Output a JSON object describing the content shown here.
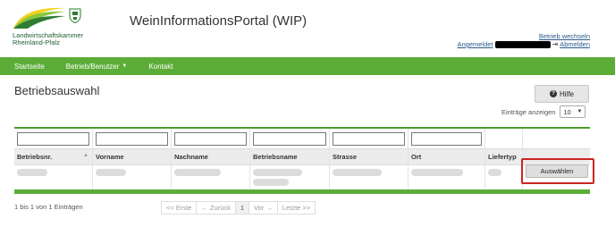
{
  "header": {
    "logo_line1": "Landwirtschaftskammer",
    "logo_line2": "Rheinland-Pfalz",
    "app_title": "WeinInformationsPortal (WIP)",
    "betrieb_wechseln": "Betrieb wechseln",
    "angemeldet_label": "Angemeldet",
    "abmelden": "Abmelden",
    "logout_icon": "logout-icon"
  },
  "navbar": {
    "items": [
      {
        "label": "Startseite"
      },
      {
        "label": "Betrieb/Benutzer",
        "has_caret": true
      },
      {
        "label": "Kontakt"
      }
    ],
    "caret": "▼"
  },
  "page": {
    "title": "Betriebsauswahl",
    "help_label": "Hilfe",
    "help_icon": "?",
    "entries_label": "Einträge anzeigen",
    "entries_value": "10"
  },
  "table": {
    "columns": [
      "Betriebsnr.",
      "Vorname",
      "Nachname",
      "Betriebsname",
      "Strasse",
      "Ort",
      "Liefertyp",
      ""
    ],
    "select_button": "Auswählen"
  },
  "footer": {
    "info": "1 bis 1 von 1 Einträgen",
    "pager": [
      "<< Erste",
      "← Zurück",
      "1",
      "Vor →",
      "Letzte >>"
    ]
  },
  "colors": {
    "nav_green": "#5cad38",
    "highlight_red": "#cc2424"
  }
}
